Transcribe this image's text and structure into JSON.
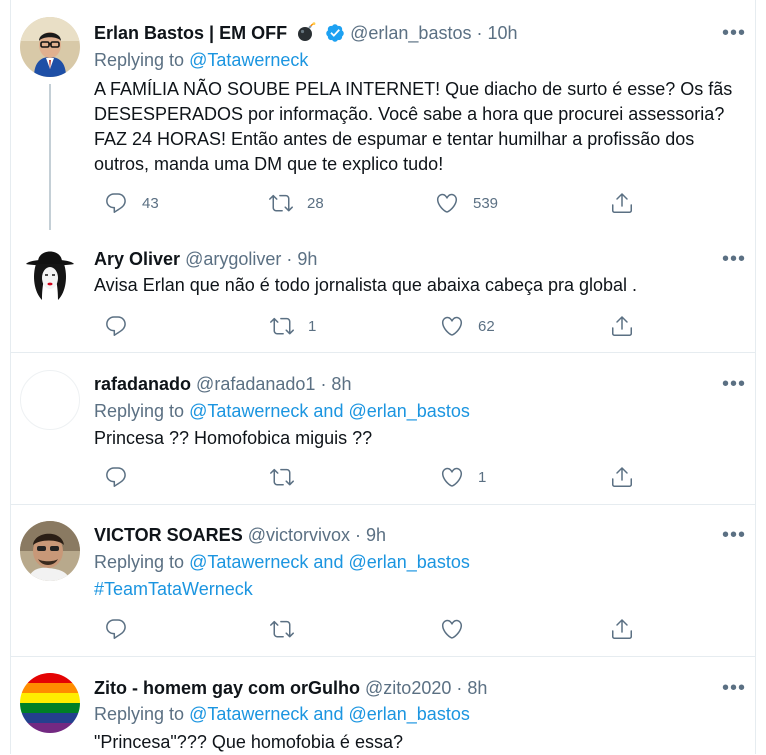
{
  "tweets": [
    {
      "name": "Erlan Bastos | EM OFF",
      "emoji": "bomb",
      "verified": true,
      "handle": "@erlan_bastos",
      "time": "· 10h",
      "replying_prefix": "Replying to",
      "replying_to": "@Tatawerneck",
      "text": "A FAMÍLIA NÃO SOUBE PELA INTERNET! Que diacho de surto é esse? Os fãs DESESPERADOS por informação. Você sabe a hora que procurei assessoria? FAZ 24 HORAS! Então antes de espumar e tentar humilhar a profissão dos outros, manda uma DM que te explico tudo!",
      "replies": "43",
      "retweets": "28",
      "likes": "539"
    },
    {
      "name": "Ary Oliver",
      "handle": "@arygoliver",
      "time": "· 9h",
      "text": "Avisa Erlan que não é todo jornalista que abaixa cabeça pra global .",
      "replies": "",
      "retweets": "1",
      "likes": "62"
    },
    {
      "name": "rafadanado",
      "handle": "@rafadanado1",
      "time": "· 8h",
      "replying_prefix": "Replying to",
      "replying_to": "@Tatawerneck",
      "replying_and": "and",
      "replying_to2": "@erlan_bastos",
      "text": "Princesa ?? Homofobica miguis ??",
      "replies": "",
      "retweets": "",
      "likes": "1"
    },
    {
      "name": "VICTOR SOARES",
      "handle": "@victorvivox",
      "time": "· 9h",
      "replying_prefix": "Replying to",
      "replying_to": "@Tatawerneck",
      "replying_and": "and",
      "replying_to2": "@erlan_bastos",
      "text": "#TeamTataWerneck",
      "replies": "",
      "retweets": "",
      "likes": ""
    },
    {
      "name": "Zito - homem gay com orGulho",
      "handle": "@zito2020",
      "time": "· 8h",
      "replying_prefix": "Replying to",
      "replying_to": "@Tatawerneck",
      "replying_and": "and",
      "replying_to2": "@erlan_bastos",
      "text": "\"Princesa\"??? Que homofobia é essa?"
    }
  ],
  "more_label": "•••",
  "colors": {
    "text": "#0f1419",
    "muted": "#5b7083",
    "link": "#1b95e0",
    "verified": "#1da1f2",
    "border": "#e6ecf0"
  }
}
